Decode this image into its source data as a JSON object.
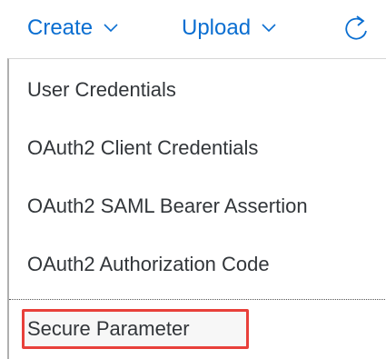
{
  "toolbar": {
    "create_label": "Create",
    "upload_label": "Upload",
    "accent_color": "#0a6ed1",
    "icons": [
      "chevron-down-icon",
      "chevron-down-icon",
      "refresh-icon"
    ]
  },
  "menu": {
    "items": [
      {
        "label": "User Credentials"
      },
      {
        "label": "OAuth2 Client Credentials"
      },
      {
        "label": "OAuth2 SAML Bearer Assertion"
      },
      {
        "label": "OAuth2 Authorization Code"
      },
      {
        "label": "Secure Parameter",
        "highlighted": true
      }
    ],
    "highlight_color": "#e8403a"
  }
}
